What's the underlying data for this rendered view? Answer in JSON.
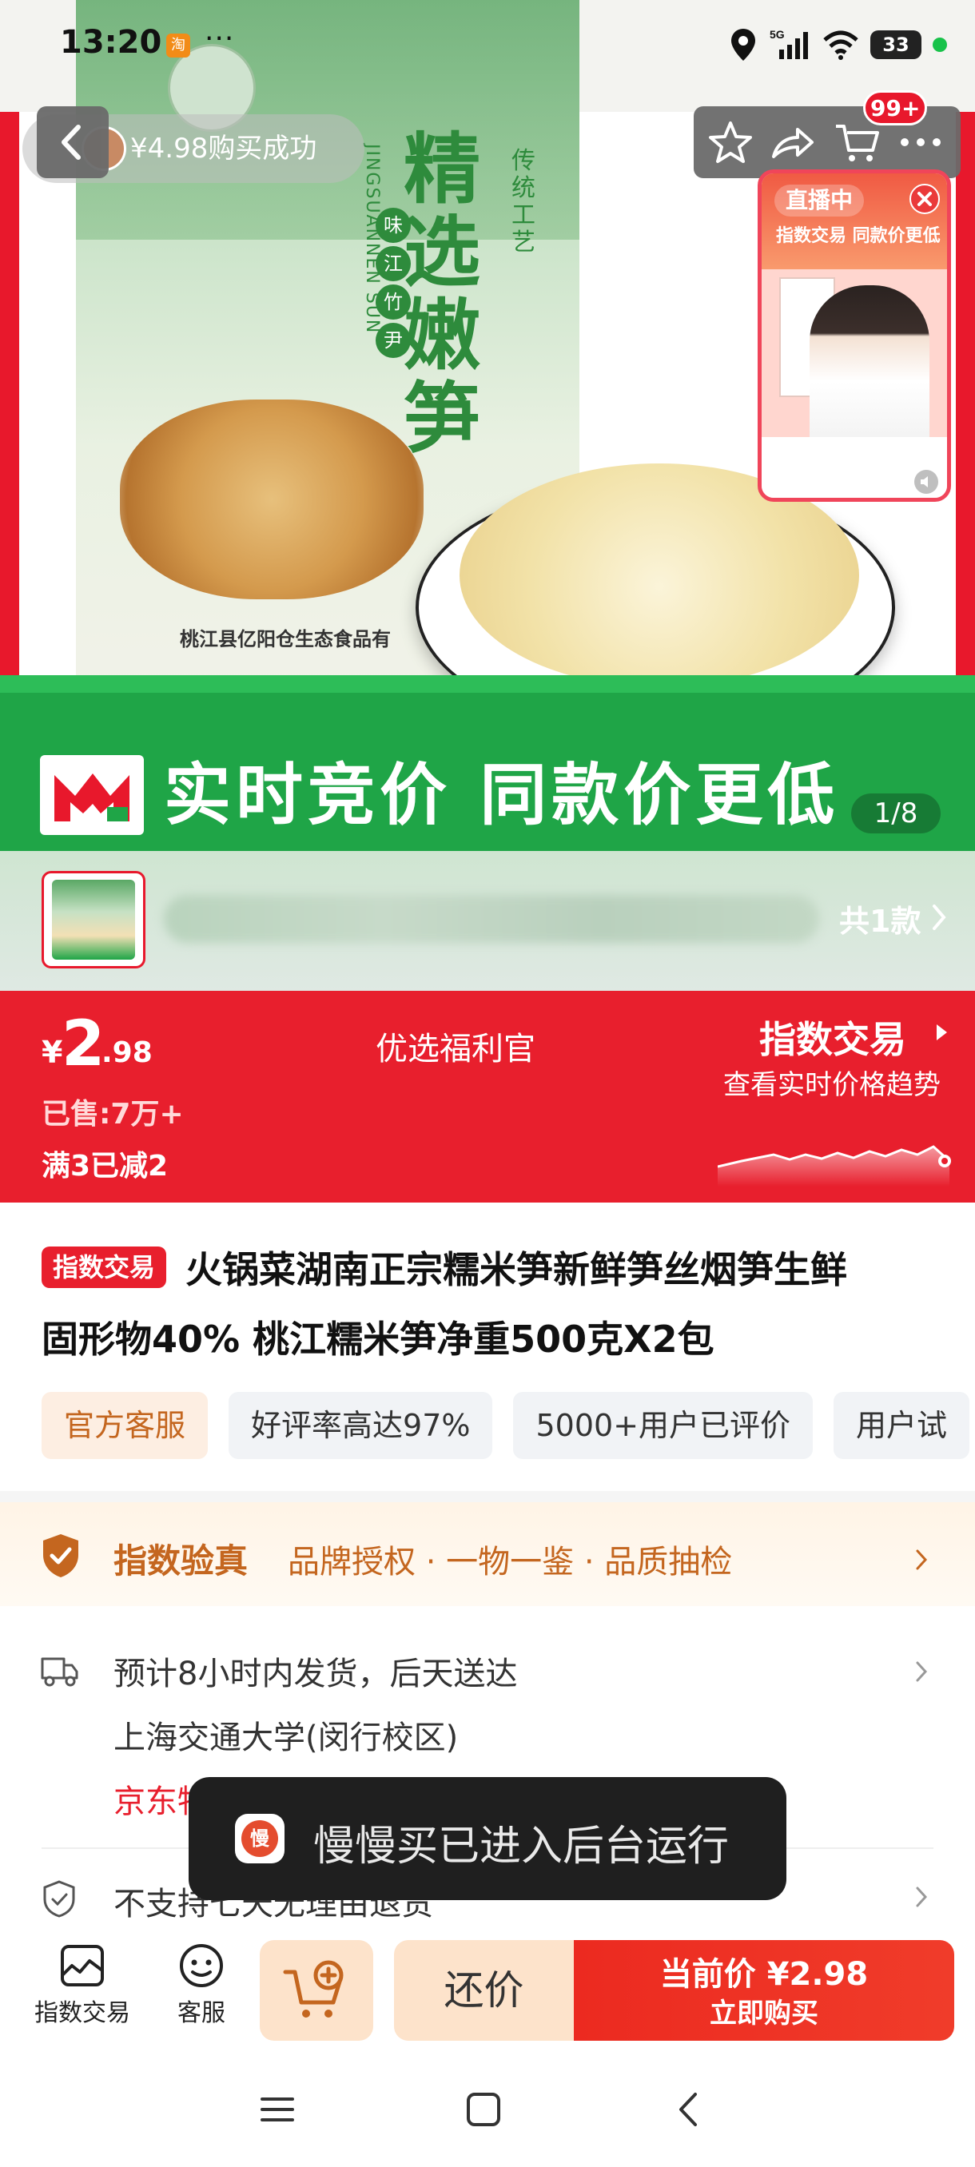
{
  "status_bar": {
    "time": "13:20",
    "taobao_badge": "淘",
    "dots": "···",
    "network": "5G",
    "battery": "33"
  },
  "top_nav": {
    "purchase_toast": "¥4.98购买成功",
    "cart_badge": "99+"
  },
  "live_widget": {
    "tag": "直播中",
    "slogan": "指数交易 同款价更低"
  },
  "hero": {
    "product_name_on_pack": "精选嫩笋",
    "pack_sub": "传统工艺",
    "pack_pills": [
      "味",
      "江",
      "竹",
      "尹"
    ],
    "pack_vertical": "JINGSUANNEN SUN",
    "pack_company": "桃江县亿阳仓生态食品有",
    "banner_text": "实时竞价 同款价更低",
    "image_counter": "1/8"
  },
  "variant": {
    "count_label": "共1款"
  },
  "price": {
    "currency": "¥",
    "integer": "2",
    "decimal": ".98",
    "sold": "已售:7万+",
    "discount": "满3已减2",
    "welfare": "优选福利官",
    "index_trade_title": "指数交易",
    "index_trade_sub": "查看实时价格趋势"
  },
  "title": {
    "tag": "指数交易",
    "line1": "火锅菜湖南正宗糯米笋新鲜笋丝烟笋生鲜",
    "line2": "固形物40% 桃江糯米笋净重500克X2包"
  },
  "chips": [
    "官方客服",
    "好评率高达97%",
    "5000+用户已评价",
    "用户试"
  ],
  "verify": {
    "title": "指数验真",
    "items": "品牌授权 · 一物一鉴 · 品质抽检"
  },
  "shipping": {
    "line1": "预计8小时内发货，后天送达",
    "line2": "上海交通大学(闵行校区)",
    "line3": "京东物"
  },
  "returns": {
    "text": "不支持七天无理由退货"
  },
  "toast": {
    "app_icon_text": "慢",
    "text": "慢慢买已进入后台运行"
  },
  "bottom_bar": {
    "index_trade": "指数交易",
    "service": "客服",
    "bargain": "还价",
    "buy_line1": "当前价 ¥2.98",
    "buy_line2": "立即购买"
  },
  "colors": {
    "brand_red": "#e81f2d",
    "banner_green": "#1fa547",
    "verify_orange": "#c4661f"
  }
}
